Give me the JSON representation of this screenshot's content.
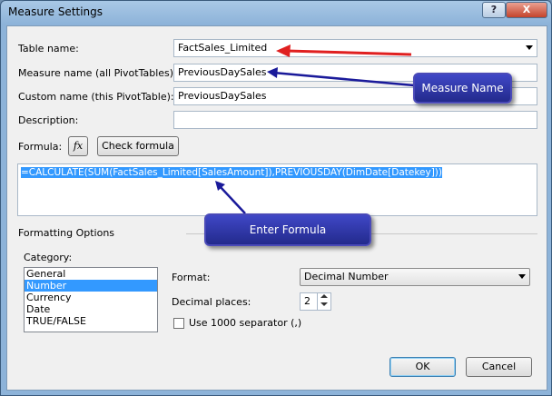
{
  "window": {
    "title": "Measure Settings",
    "help_label": "?",
    "close_label": "X"
  },
  "form": {
    "table_name_label": "Table name:",
    "table_name_value": "FactSales_Limited",
    "measure_name_label": "Measure name (all PivotTables):",
    "measure_name_value": "PreviousDaySales",
    "custom_name_label": "Custom name (this PivotTable):",
    "custom_name_value": "PreviousDaySales",
    "description_label": "Description:",
    "description_value": "",
    "formula_label": "Formula:",
    "fx_label": "fx",
    "check_formula_label": "Check formula",
    "formula_text": "=CALCULATE(SUM(FactSales_Limited[SalesAmount]),PREVIOUSDAY(DimDate[Datekey]))"
  },
  "formatting": {
    "group_label": "Formatting Options",
    "category_label": "Category:",
    "categories": [
      "General",
      "Number",
      "Currency",
      "Date",
      "TRUE/FALSE"
    ],
    "selected_category": "Number",
    "format_label": "Format:",
    "format_value": "Decimal Number",
    "decimal_places_label": "Decimal places:",
    "decimal_places_value": "2",
    "separator_label": "Use 1000 separator (,)"
  },
  "buttons": {
    "ok_label": "OK",
    "cancel_label": "Cancel"
  },
  "annotations": {
    "measure_name_callout": "Measure Name",
    "enter_formula_callout": "Enter Formula"
  },
  "colors": {
    "accent_selection": "#3399ff",
    "callout_fill": "#2b33a8",
    "arrow_red": "#e02020",
    "arrow_blue": "#1a1a9a"
  }
}
